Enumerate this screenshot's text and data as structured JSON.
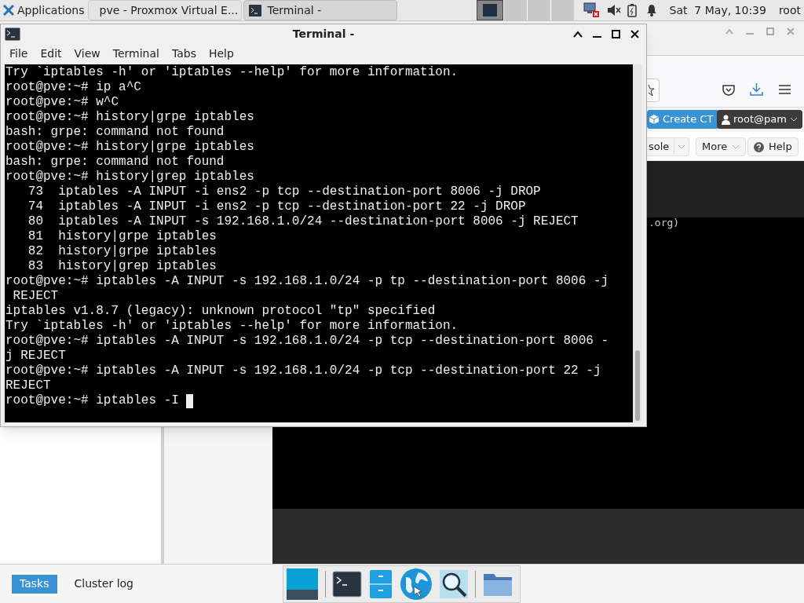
{
  "top_panel": {
    "applications": "Applications",
    "tasks": [
      {
        "kind": "browser",
        "title": "pve - Proxmox Virtual E...",
        "selected": false
      },
      {
        "kind": "terminal",
        "title": "Terminal -",
        "selected": true
      }
    ],
    "clock": "Sat  7 May, 10:39",
    "user": "root"
  },
  "terminal": {
    "title": "Terminal -",
    "menu": [
      "File",
      "Edit",
      "View",
      "Terminal",
      "Tabs",
      "Help"
    ],
    "lines": [
      "Try `iptables -h' or 'iptables --help' for more information.",
      "root@pve:~# ip a^C",
      "root@pve:~# w^C",
      "root@pve:~# history|grpe iptables",
      "bash: grpe: command not found",
      "root@pve:~# history|grpe iptables",
      "bash: grpe: command not found",
      "root@pve:~# history|grep iptables",
      "   73  iptables -A INPUT -i ens2 -p tcp --destination-port 8006 -j DROP",
      "   74  iptables -A INPUT -i ens2 -p tcp --destination-port 22 -j DROP",
      "   80  iptables -A INPUT -s 192.168.1.0/24 --destination-port 8006 -j REJECT",
      "   81  history|grpe iptables",
      "   82  history|grpe iptables",
      "   83  history|grep iptables",
      "root@pve:~# iptables -A INPUT -s 192.168.1.0/24 -p tp --destination-port 8006 -j",
      " REJECT",
      "iptables v1.8.7 (legacy): unknown protocol \"tp\" specified",
      "Try `iptables -h' or 'iptables --help' for more information.",
      "root@pve:~# iptables -A INPUT -s 192.168.1.0/24 -p tcp --destination-port 8006 -",
      "j REJECT",
      "root@pve:~# iptables -A INPUT -s 192.168.1.0/24 -p tcp --destination-port 22 -j",
      "REJECT",
      "root@pve:~# iptables -I "
    ]
  },
  "browser": {
    "create_button": "Create CT",
    "user_button": "root@pam",
    "toolbar": [
      {
        "kind": "split",
        "label": "sole"
      },
      {
        "kind": "menu",
        "label": "More"
      },
      {
        "kind": "help",
        "label": "Help"
      }
    ],
    "console_text": ".org)",
    "bottom_tabs": [
      {
        "label": "Tasks",
        "selected": true
      },
      {
        "label": "Cluster log",
        "selected": false
      }
    ]
  }
}
